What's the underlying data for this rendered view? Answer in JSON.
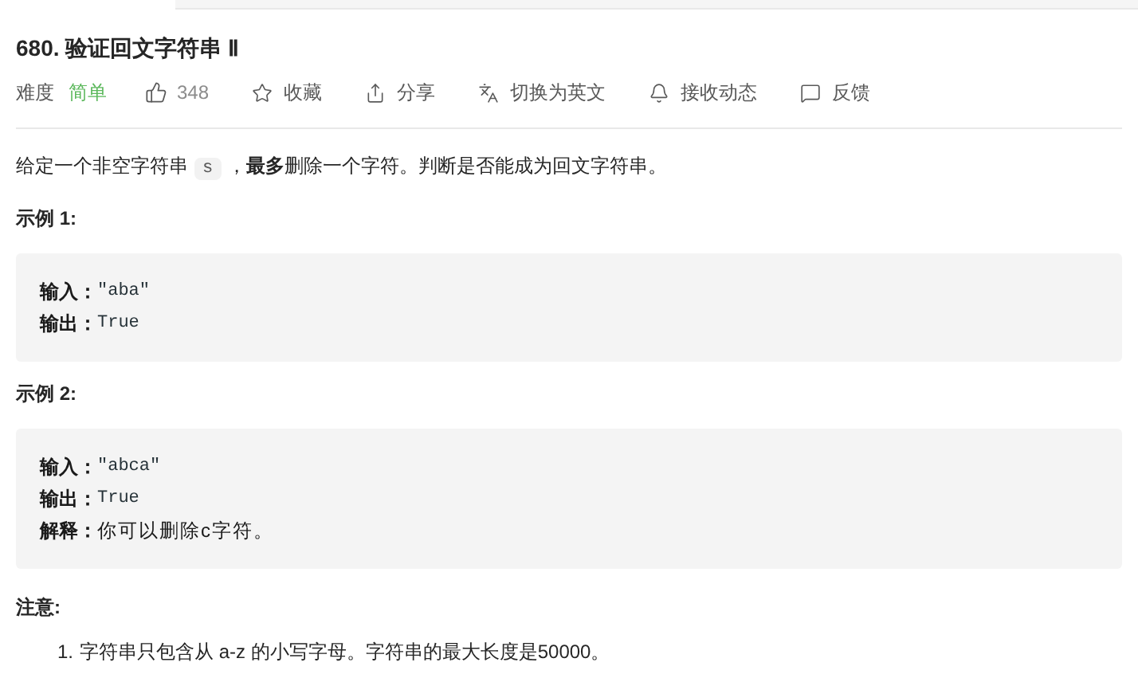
{
  "title": "680. 验证回文字符串 Ⅱ",
  "meta": {
    "difficulty_label": "难度",
    "difficulty": "简单",
    "likes": "348",
    "actions": [
      {
        "kind": "star",
        "label": "收藏"
      },
      {
        "kind": "share",
        "label": "分享"
      },
      {
        "kind": "translate",
        "label": "切换为英文"
      },
      {
        "kind": "bell",
        "label": "接收动态"
      },
      {
        "kind": "feedback",
        "label": "反馈"
      }
    ]
  },
  "description": {
    "before": "给定一个非空字符串",
    "code": "s",
    "after": "，**最多**删除一个字符。判断是否能成为回文字符串。"
  },
  "examples": [
    {
      "heading": "示例 1:",
      "lines": [
        {
          "label": "输入：",
          "kind": "code",
          "value": "\"aba\""
        },
        {
          "label": "输出：",
          "kind": "code",
          "value": "True"
        }
      ]
    },
    {
      "heading": "示例 2:",
      "lines": [
        {
          "label": "输入：",
          "kind": "code",
          "value": "\"abca\""
        },
        {
          "label": "输出：",
          "kind": "code",
          "value": "True"
        },
        {
          "label": "解释：",
          "kind": "text",
          "value": "你可以删除c字符。"
        }
      ]
    }
  ],
  "note": {
    "heading": "注意:",
    "items": [
      {
        "marker": "1.",
        "text": "字符串只包含从 a-z 的小写字母。字符串的最大长度是50000。"
      }
    ]
  }
}
